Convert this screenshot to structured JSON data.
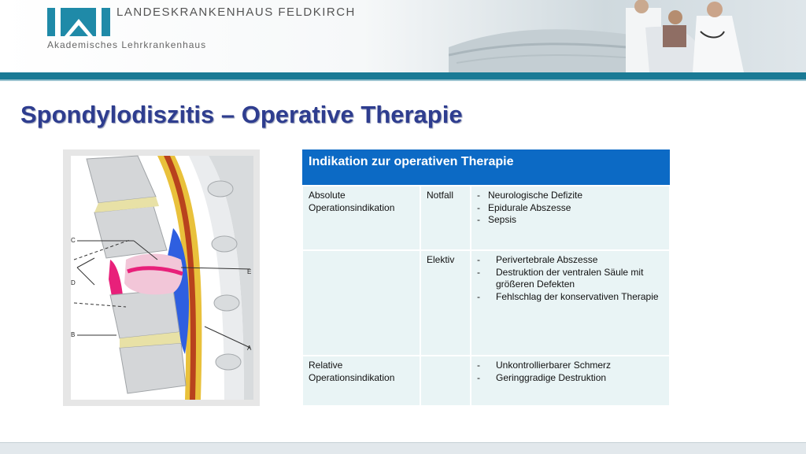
{
  "header": {
    "hospital_name": "LANDESKRANKENHAUS FELDKIRCH",
    "subtitle": "Akademisches Lehrkrankenhaus",
    "logo_icon": "lkh-logo-icon",
    "colors": {
      "stripe": "#1a7a95",
      "logo": "#1f8aa8"
    }
  },
  "title": "Spondylodiszitis – Operative Therapie",
  "illustration": {
    "icon": "spine-cross-section-illustration",
    "labels": [
      "C",
      "D",
      "B",
      "E",
      "A"
    ]
  },
  "table": {
    "header": "Indikation zur operativen Therapie",
    "rows": [
      {
        "category": "Absolute Operationsindikation",
        "type": "Notfall",
        "items": [
          "Neurologische Defizite",
          "Epidurale Abszesse",
          "Sepsis"
        ]
      },
      {
        "category": "",
        "type": "Elektiv",
        "items": [
          "Perivertebrale Abszesse",
          "Destruktion der ventralen Säule mit größeren Defekten",
          "Fehlschlag der konservativen Therapie"
        ]
      },
      {
        "category": "Relative Operationsindikation",
        "type": "",
        "items": [
          "Unkontrollierbarer Schmerz",
          "Geringgradige Destruktion"
        ]
      }
    ],
    "colors": {
      "header_bg": "#0c6ac5",
      "cell_bg": "#e9f4f5"
    }
  }
}
